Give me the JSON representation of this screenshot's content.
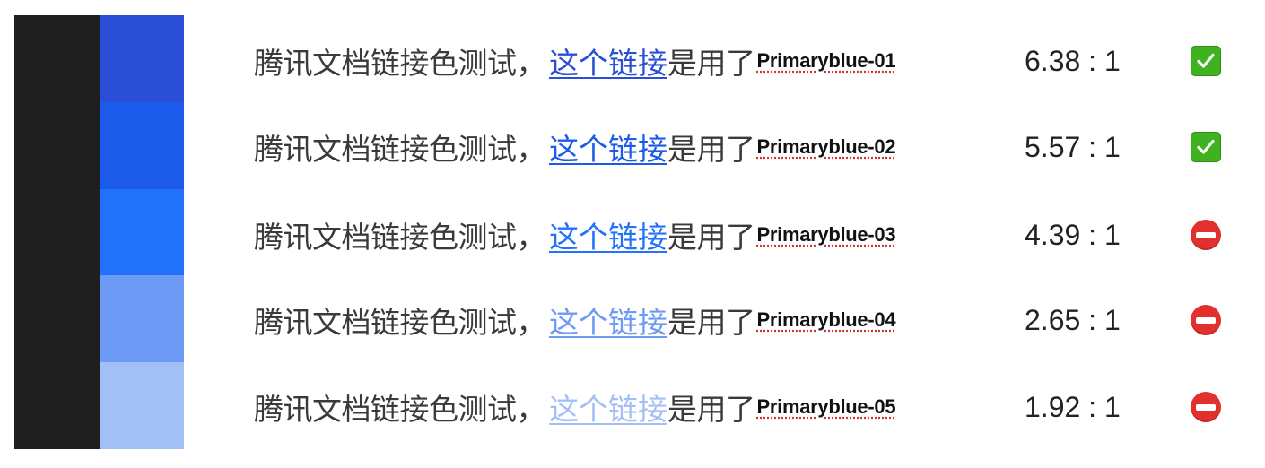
{
  "swatches": [
    {
      "color": "#2a4fd6"
    },
    {
      "color": "#1c5bea"
    },
    {
      "color": "#2372fb"
    },
    {
      "color": "#6d9af4"
    },
    {
      "color": "#a3c0f6"
    }
  ],
  "rows": [
    {
      "prefix": "腾讯文档链接色测试，",
      "link_text": "这个链接",
      "link_color": "#2a4fd6",
      "suffix": "是用了",
      "token": "Primaryblue-01",
      "ratio": "6.38 : 1",
      "status": "pass",
      "status_icon": "check-icon"
    },
    {
      "prefix": "腾讯文档链接色测试，",
      "link_text": "这个链接",
      "link_color": "#1c5bea",
      "suffix": "是用了",
      "token": "Primaryblue-02",
      "ratio": "5.57 : 1",
      "status": "pass",
      "status_icon": "check-icon"
    },
    {
      "prefix": "腾讯文档链接色测试，",
      "link_text": "这个链接",
      "link_color": "#2372fb",
      "suffix": "是用了",
      "token": "Primaryblue-03",
      "ratio": "4.39 : 1",
      "status": "fail",
      "status_icon": "no-entry-icon"
    },
    {
      "prefix": "腾讯文档链接色测试，",
      "link_text": "这个链接",
      "link_color": "#6d9af4",
      "suffix": "是用了",
      "token": "Primaryblue-04",
      "ratio": "2.65 : 1",
      "status": "fail",
      "status_icon": "no-entry-icon"
    },
    {
      "prefix": "腾讯文档链接色测试，",
      "link_text": "这个链接",
      "link_color": "#a3c0f6",
      "suffix": "是用了",
      "token": "Primaryblue-05",
      "ratio": "1.92 : 1",
      "status": "fail",
      "status_icon": "no-entry-icon"
    }
  ]
}
